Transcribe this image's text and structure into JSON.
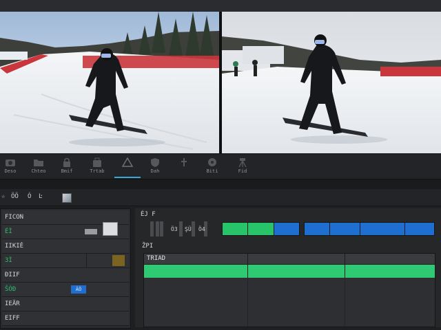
{
  "toolbar": {
    "tools": [
      {
        "label": "Deso",
        "icon": "camera-icon"
      },
      {
        "label": "Chteo",
        "icon": "folder-icon"
      },
      {
        "label": "Bmif",
        "icon": "lock-icon"
      },
      {
        "label": "Trtab",
        "icon": "bag-icon"
      },
      {
        "label": "",
        "icon": "triangle-icon",
        "active": true
      },
      {
        "label": "Dah",
        "icon": "shield-icon"
      },
      {
        "label": "",
        "icon": "pin-icon"
      },
      {
        "label": "Biti",
        "icon": "disc-icon"
      },
      {
        "label": "Fid",
        "icon": "tripod-icon"
      }
    ]
  },
  "subbar": {
    "star": "☆",
    "a": "ÖÖ",
    "b": "Ó",
    "c": "Ŀ"
  },
  "left_panel": {
    "rows": [
      {
        "label": "FICON",
        "green": false
      },
      {
        "label": "ÉÌ",
        "green": true
      },
      {
        "label": "IIKIĖ",
        "green": false
      },
      {
        "label": "ЗÌ",
        "green": true
      },
      {
        "label": "ÐIIF",
        "green": false
      },
      {
        "label": "ŠÓÐ",
        "green": true
      },
      {
        "label": "IEÄR",
        "green": false
      },
      {
        "label": "EIFF",
        "green": false
      }
    ],
    "badge": "ÄÖ"
  },
  "timeline": {
    "track1_label": "ÉJ F",
    "meter_labels": [
      "Ö3",
      "ŞÜ",
      "Ö4"
    ],
    "track2_label": "ŽPI",
    "lane_title": "TRIAD"
  },
  "colors": {
    "clip_green": "#27c46a",
    "clip_blue": "#1f6fd0",
    "accent": "#37a7d8"
  }
}
